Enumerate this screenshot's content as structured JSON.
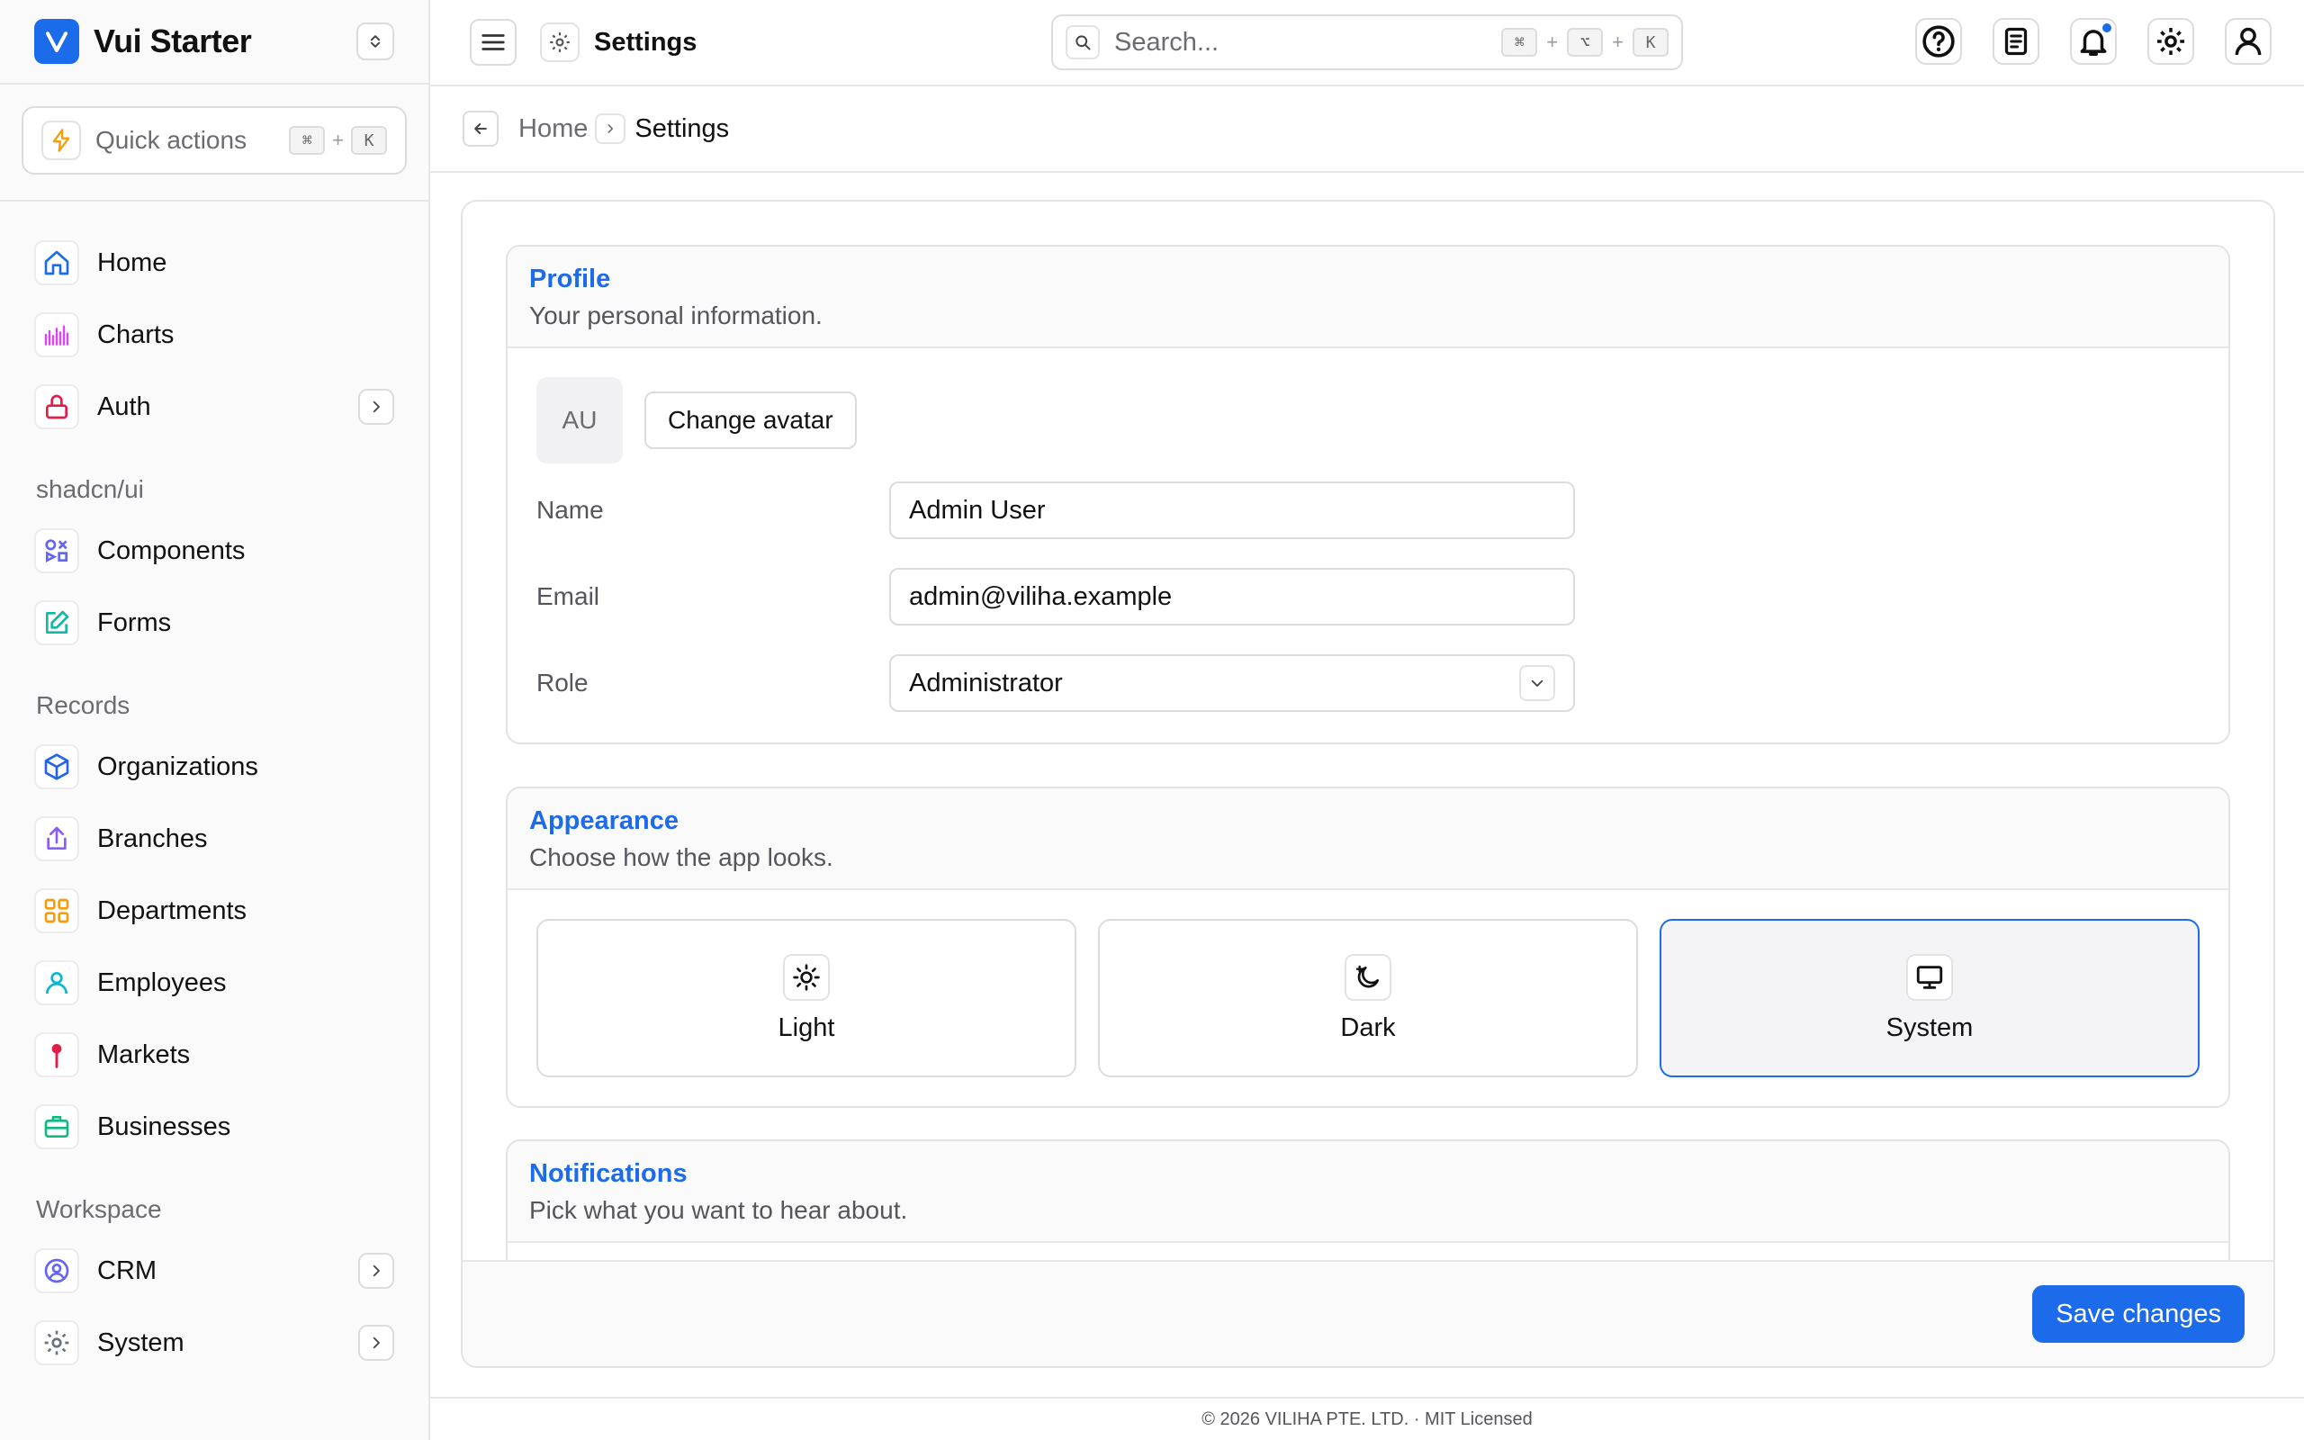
{
  "brand": {
    "name": "Vui Starter"
  },
  "quick_actions": {
    "label": "Quick actions",
    "kbd": [
      "⌘",
      "K"
    ],
    "plus": "+"
  },
  "sidebar": {
    "items": [
      {
        "label": "Home"
      },
      {
        "label": "Charts"
      },
      {
        "label": "Auth"
      }
    ],
    "section_shadcn": "shadcn/ui",
    "shadcn_items": [
      {
        "label": "Components"
      },
      {
        "label": "Forms"
      }
    ],
    "section_records": "Records",
    "records_items": [
      {
        "label": "Organizations"
      },
      {
        "label": "Branches"
      },
      {
        "label": "Departments"
      },
      {
        "label": "Employees"
      },
      {
        "label": "Markets"
      },
      {
        "label": "Businesses"
      }
    ],
    "section_workspace": "Workspace",
    "workspace_items": [
      {
        "label": "CRM"
      },
      {
        "label": "System"
      }
    ]
  },
  "topbar": {
    "title": "Settings",
    "search_placeholder": "Search...",
    "search_kbd": [
      "⌘",
      "⌥",
      "K"
    ],
    "plus": "+"
  },
  "breadcrumb": {
    "home": "Home",
    "current": "Settings"
  },
  "profile": {
    "title": "Profile",
    "subtitle": "Your personal information.",
    "avatar_initials": "AU",
    "change_avatar": "Change avatar",
    "name_label": "Name",
    "name_value": "Admin User",
    "email_label": "Email",
    "email_value": "admin@viliha.example",
    "role_label": "Role",
    "role_value": "Administrator"
  },
  "appearance": {
    "title": "Appearance",
    "subtitle": "Choose how the app looks.",
    "options": [
      {
        "label": "Light"
      },
      {
        "label": "Dark"
      },
      {
        "label": "System"
      }
    ],
    "selected": "System"
  },
  "notifications": {
    "title": "Notifications",
    "subtitle": "Pick what you want to hear about."
  },
  "actions": {
    "save": "Save changes"
  },
  "footer": {
    "text": "© 2026 VILIHA PTE. LTD. · MIT Licensed"
  },
  "colors": {
    "accent": "#1c6bea",
    "border": "#dcdce0"
  }
}
